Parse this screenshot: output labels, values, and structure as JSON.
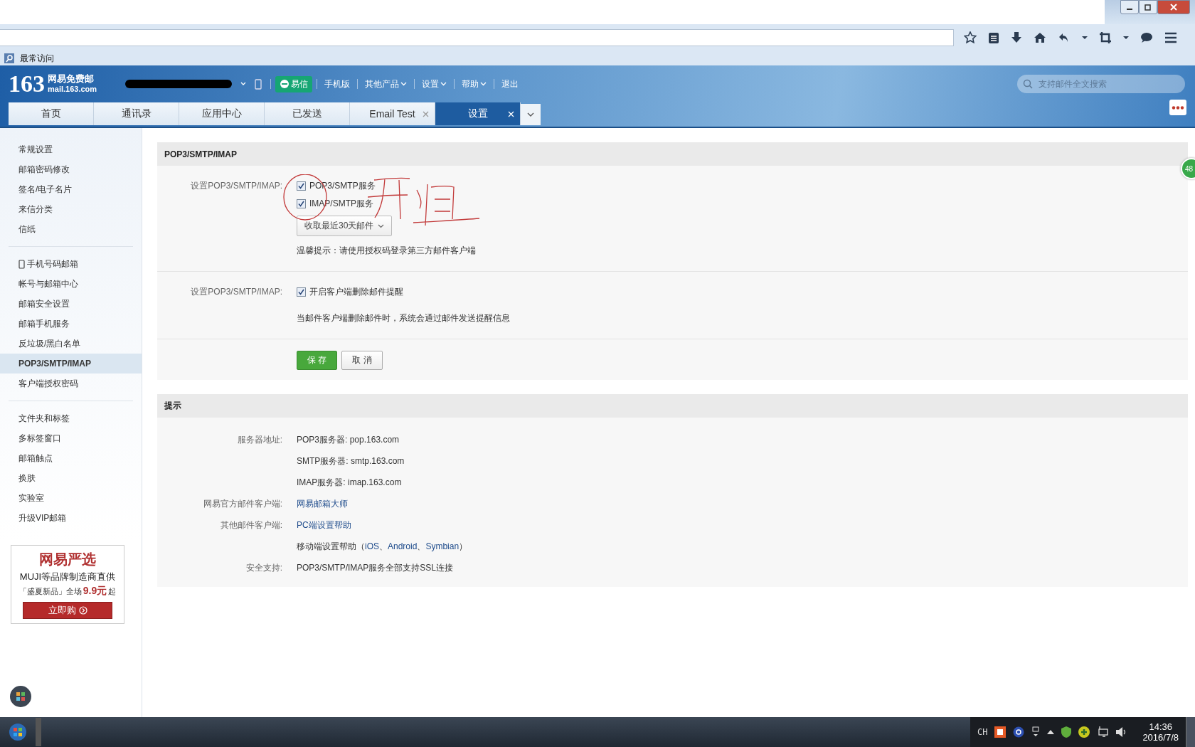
{
  "browser": {
    "bookmark": "最常访问"
  },
  "header": {
    "logo_number": "163",
    "logo_name": "网易免费邮",
    "logo_domain": "mail.163.com",
    "yixin": "易信",
    "nav": [
      {
        "label": "手机版",
        "dropdown": false
      },
      {
        "label": "其他产品",
        "dropdown": true
      },
      {
        "label": "设置",
        "dropdown": true
      },
      {
        "label": "帮助",
        "dropdown": true
      },
      {
        "label": "退出",
        "dropdown": false
      }
    ],
    "search": {
      "placeholder": "支持邮件全文搜索"
    }
  },
  "tabs": [
    {
      "label": "首页",
      "selected": false,
      "closable": false
    },
    {
      "label": "通讯录",
      "selected": false,
      "closable": false
    },
    {
      "label": "应用中心",
      "selected": false,
      "closable": false
    },
    {
      "label": "已发送",
      "selected": false,
      "closable": false
    },
    {
      "label": "Email Test",
      "selected": false,
      "closable": true
    },
    {
      "label": "设置",
      "selected": true,
      "closable": true
    }
  ],
  "sidebar": {
    "groups": [
      [
        {
          "label": "常规设置",
          "selected": false,
          "kind": "text"
        },
        {
          "label": "邮箱密码修改",
          "selected": false,
          "kind": "text"
        },
        {
          "label": "签名/电子名片",
          "selected": false,
          "kind": "text"
        },
        {
          "label": "来信分类",
          "selected": false,
          "kind": "text"
        },
        {
          "label": "信纸",
          "selected": false,
          "kind": "text"
        }
      ],
      [
        {
          "label": "手机号码邮箱",
          "selected": false,
          "kind": "phone"
        },
        {
          "label": "帐号与邮箱中心",
          "selected": false,
          "kind": "text"
        },
        {
          "label": "邮箱安全设置",
          "selected": false,
          "kind": "text"
        },
        {
          "label": "邮箱手机服务",
          "selected": false,
          "kind": "text"
        },
        {
          "label": "反垃圾/黑白名单",
          "selected": false,
          "kind": "text"
        },
        {
          "label": "POP3/SMTP/IMAP",
          "selected": true,
          "kind": "text"
        },
        {
          "label": "客户端授权密码",
          "selected": false,
          "kind": "text"
        }
      ],
      [
        {
          "label": "文件夹和标签",
          "selected": false,
          "kind": "text"
        },
        {
          "label": "多标签窗口",
          "selected": false,
          "kind": "text"
        },
        {
          "label": "邮箱触点",
          "selected": false,
          "kind": "text"
        },
        {
          "label": "换肤",
          "selected": false,
          "kind": "text"
        },
        {
          "label": "实验室",
          "selected": false,
          "kind": "text"
        },
        {
          "label": "升级VIP邮箱",
          "selected": false,
          "kind": "text"
        }
      ]
    ],
    "ad": {
      "title": "网易严选",
      "line1": "MUJI等品牌制造商直供",
      "line2_prefix": "「盛夏新品」全场",
      "price": "9.9元",
      "line2_suffix": "起",
      "button": "立即购"
    }
  },
  "settings": {
    "title": "POP3/SMTP/IMAP",
    "group1": {
      "label": "设置POP3/SMTP/IMAP:",
      "options": [
        {
          "label": "POP3/SMTP服务",
          "checked": true
        },
        {
          "label": "IMAP/SMTP服务",
          "checked": true
        }
      ],
      "select": "收取最近30天邮件",
      "tip": "温馨提示：请使用授权码登录第三方邮件客户端"
    },
    "group2": {
      "label": "设置POP3/SMTP/IMAP:",
      "options": [
        {
          "label": "开启客户端删除邮件提醒",
          "checked": true
        }
      ],
      "note": "当邮件客户端删除邮件时，系统会通过邮件发送提醒信息"
    },
    "buttons": {
      "save": "保 存",
      "cancel": "取 消"
    }
  },
  "tips": {
    "title": "提示",
    "rows": [
      {
        "label": "服务器地址:",
        "parts": [
          {
            "text": "POP3服务器: pop.163.com",
            "kind": "text"
          }
        ]
      },
      {
        "label": "",
        "parts": [
          {
            "text": "SMTP服务器: smtp.163.com",
            "kind": "text"
          }
        ]
      },
      {
        "label": "",
        "parts": [
          {
            "text": "IMAP服务器: imap.163.com",
            "kind": "text"
          }
        ]
      },
      {
        "label": "网易官方邮件客户端:",
        "parts": [
          {
            "text": "网易邮箱大师",
            "kind": "link"
          }
        ]
      },
      {
        "label": "其他邮件客户端:",
        "parts": [
          {
            "text": "PC端设置帮助",
            "kind": "link"
          }
        ]
      },
      {
        "label": "",
        "parts": [
          {
            "text": "移动端设置帮助（",
            "kind": "text"
          },
          {
            "text": "iOS",
            "kind": "link"
          },
          {
            "text": "、",
            "kind": "text"
          },
          {
            "text": "Android",
            "kind": "link"
          },
          {
            "text": "、",
            "kind": "text"
          },
          {
            "text": "Symbian",
            "kind": "link"
          },
          {
            "text": "）",
            "kind": "text"
          }
        ]
      },
      {
        "label": "安全支持:",
        "parts": [
          {
            "text": "POP3/SMTP/IMAP服务全部支持SSL连接",
            "kind": "text"
          }
        ]
      }
    ]
  },
  "float_badge": "48",
  "taskbar": {
    "lang": "CH",
    "time": "14:36",
    "date": "2016/7/8"
  }
}
